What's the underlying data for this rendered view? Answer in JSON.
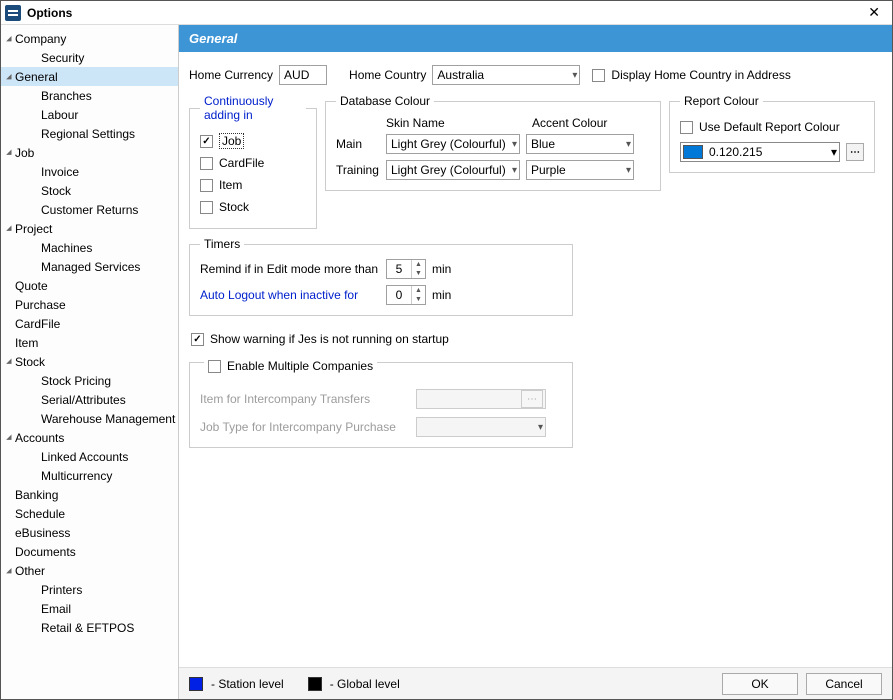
{
  "window": {
    "title": "Options"
  },
  "sidebar": {
    "selected": "General",
    "nodes": [
      {
        "label": "Company",
        "expandable": true,
        "indent": 0
      },
      {
        "label": "Security",
        "expandable": false,
        "indent": 1
      },
      {
        "label": "General",
        "expandable": true,
        "indent": 0,
        "selected": true
      },
      {
        "label": "Branches",
        "expandable": false,
        "indent": 1
      },
      {
        "label": "Labour",
        "expandable": false,
        "indent": 1
      },
      {
        "label": "Regional Settings",
        "expandable": false,
        "indent": 1
      },
      {
        "label": "Job",
        "expandable": true,
        "indent": 0
      },
      {
        "label": "Invoice",
        "expandable": false,
        "indent": 1
      },
      {
        "label": "Stock",
        "expandable": false,
        "indent": 1
      },
      {
        "label": "Customer Returns",
        "expandable": false,
        "indent": 1
      },
      {
        "label": "Project",
        "expandable": true,
        "indent": 0
      },
      {
        "label": "Machines",
        "expandable": false,
        "indent": 1
      },
      {
        "label": "Managed Services",
        "expandable": false,
        "indent": 1
      },
      {
        "label": "Quote",
        "expandable": false,
        "indent": 0
      },
      {
        "label": "Purchase",
        "expandable": false,
        "indent": 0
      },
      {
        "label": "CardFile",
        "expandable": false,
        "indent": 0
      },
      {
        "label": "Item",
        "expandable": false,
        "indent": 0
      },
      {
        "label": "Stock",
        "expandable": true,
        "indent": 0
      },
      {
        "label": "Stock Pricing",
        "expandable": false,
        "indent": 1
      },
      {
        "label": "Serial/Attributes",
        "expandable": false,
        "indent": 1
      },
      {
        "label": "Warehouse Management",
        "expandable": false,
        "indent": 1
      },
      {
        "label": "Accounts",
        "expandable": true,
        "indent": 0
      },
      {
        "label": "Linked Accounts",
        "expandable": false,
        "indent": 1
      },
      {
        "label": "Multicurrency",
        "expandable": false,
        "indent": 1
      },
      {
        "label": "Banking",
        "expandable": false,
        "indent": 0
      },
      {
        "label": "Schedule",
        "expandable": false,
        "indent": 0
      },
      {
        "label": "eBusiness",
        "expandable": false,
        "indent": 0
      },
      {
        "label": "Documents",
        "expandable": false,
        "indent": 0
      },
      {
        "label": "Other",
        "expandable": true,
        "indent": 0
      },
      {
        "label": "Printers",
        "expandable": false,
        "indent": 1
      },
      {
        "label": "Email",
        "expandable": false,
        "indent": 1
      },
      {
        "label": "Retail & EFTPOS",
        "expandable": false,
        "indent": 1
      }
    ]
  },
  "panel": {
    "title": "General",
    "home_currency_label": "Home Currency",
    "home_currency_value": "AUD",
    "home_country_label": "Home Country",
    "home_country_value": "Australia",
    "display_home_country_label": "Display Home Country in Address",
    "display_home_country_checked": false,
    "continuously_legend": "Continuously adding in",
    "continuously": {
      "job": {
        "label": "Job",
        "checked": true
      },
      "cardfile": {
        "label": "CardFile",
        "checked": false
      },
      "item": {
        "label": "Item",
        "checked": false
      },
      "stock": {
        "label": "Stock",
        "checked": false
      }
    },
    "dbcolour_legend": "Database Colour",
    "dbcolour": {
      "skin_header": "Skin Name",
      "accent_header": "Accent Colour",
      "main_label": "Main",
      "main_skin": "Light Grey (Colourful)",
      "main_accent": "Blue",
      "training_label": "Training",
      "training_skin": "Light Grey (Colourful)",
      "training_accent": "Purple"
    },
    "reportcolour_legend": "Report Colour",
    "reportcolour": {
      "use_default_label": "Use Default Report Colour",
      "use_default_checked": false,
      "value": "0.120.215",
      "swatch": "#0078d7"
    },
    "timers_legend": "Timers",
    "timers": {
      "remind_label": "Remind if in Edit mode more than",
      "remind_value": "5",
      "remind_unit": "min",
      "logout_label": "Auto Logout when inactive for",
      "logout_value": "0",
      "logout_unit": "min"
    },
    "show_warning_label": "Show warning if Jes is not running on startup",
    "show_warning_checked": true,
    "multi_legend": "",
    "multi": {
      "enable_label": "Enable Multiple Companies",
      "enable_checked": false,
      "item_label": "Item for Intercompany Transfers",
      "jobtype_label": "Job Type for Intercompany Purchase"
    }
  },
  "footer": {
    "station_colour": "#0020e6",
    "station_label": "- Station level",
    "global_colour": "#000000",
    "global_label": "- Global level",
    "ok": "OK",
    "cancel": "Cancel"
  }
}
